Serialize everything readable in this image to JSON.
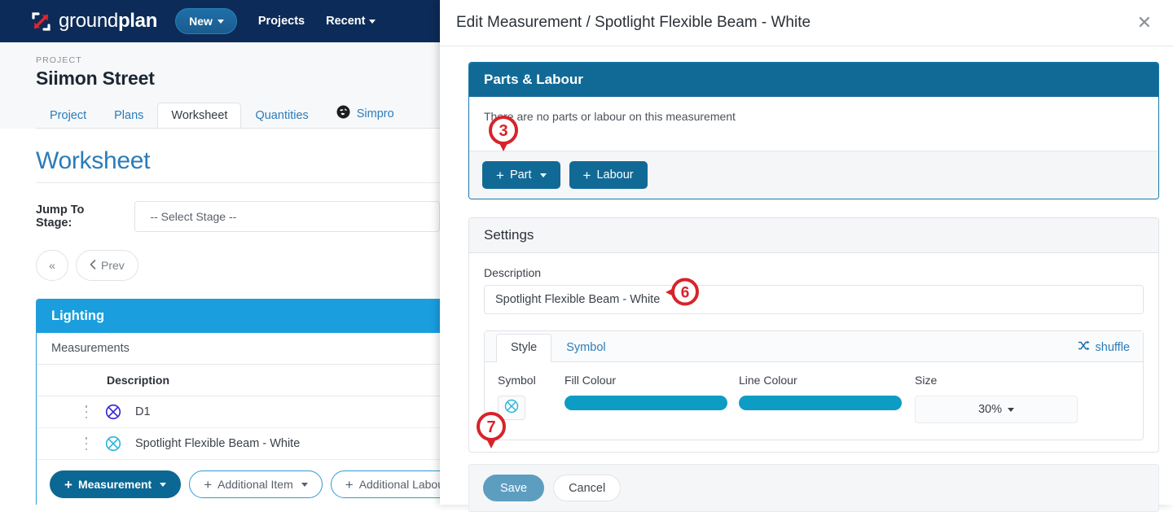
{
  "nav": {
    "logo_text_light": "ground",
    "logo_text_bold": "plan",
    "logo_icon": "groundplan-arrow-icon",
    "new_button": "New",
    "projects_link": "Projects",
    "recent_link": "Recent"
  },
  "page": {
    "project_label": "PROJECT",
    "project_name": "Siimon Street",
    "tabs": [
      {
        "label": "Project",
        "active": false
      },
      {
        "label": "Plans",
        "active": false
      },
      {
        "label": "Worksheet",
        "active": true
      },
      {
        "label": "Quantities",
        "active": false
      },
      {
        "label": "Simpro",
        "active": false,
        "icon": "simpro-globe-icon"
      }
    ],
    "heading": "Worksheet",
    "jump_to_stage_label": "Jump To Stage:",
    "jump_to_stage_value": "-- Select Stage --",
    "pager": {
      "first": "«",
      "prev": "Prev"
    }
  },
  "worksheet_card": {
    "title": "Lighting",
    "section_label": "Measurements",
    "column_header": "Description",
    "rows": [
      {
        "description": "D1",
        "symbol": "crossed-circle",
        "symbol_colour": "#3423d6"
      },
      {
        "description": "Spotlight Flexible Beam - White",
        "symbol": "crossed-circle",
        "symbol_colour": "#2ab5dd"
      }
    ],
    "buttons": [
      {
        "label": "Measurement",
        "style": "primary",
        "has_caret": true
      },
      {
        "label": "Additional Item",
        "style": "ghost",
        "has_caret": true
      },
      {
        "label": "Additional Labour",
        "style": "ghost",
        "has_caret": false
      }
    ]
  },
  "modal": {
    "title": "Edit Measurement / Spotlight Flexible Beam - White",
    "close_icon": "close-icon",
    "parts_labour": {
      "heading": "Parts & Labour",
      "empty_text": "There are no parts or labour on this measurement",
      "add_part_label": "Part",
      "add_labour_label": "Labour"
    },
    "settings": {
      "heading": "Settings",
      "description_label": "Description",
      "description_value": "Spotlight Flexible Beam - White",
      "tabs": [
        {
          "label": "Style",
          "active": true
        },
        {
          "label": "Symbol",
          "active": false
        }
      ],
      "shuffle_label": "shuffle",
      "shuffle_icon": "shuffle-icon",
      "style": {
        "symbol_label": "Symbol",
        "symbol_icon": "crossed-circle",
        "symbol_colour": "#2ab5dd",
        "fill_colour_label": "Fill Colour",
        "fill_colour": "#0d9cc4",
        "line_colour_label": "Line Colour",
        "line_colour": "#0d9cc4",
        "size_label": "Size",
        "size_value": "30%"
      }
    },
    "footer": {
      "save_label": "Save",
      "cancel_label": "Cancel"
    }
  },
  "annotations": {
    "colour": "#d8232a",
    "markers": [
      {
        "number": "3",
        "points": "down"
      },
      {
        "number": "6",
        "points": "left"
      },
      {
        "number": "7",
        "points": "down"
      }
    ]
  }
}
